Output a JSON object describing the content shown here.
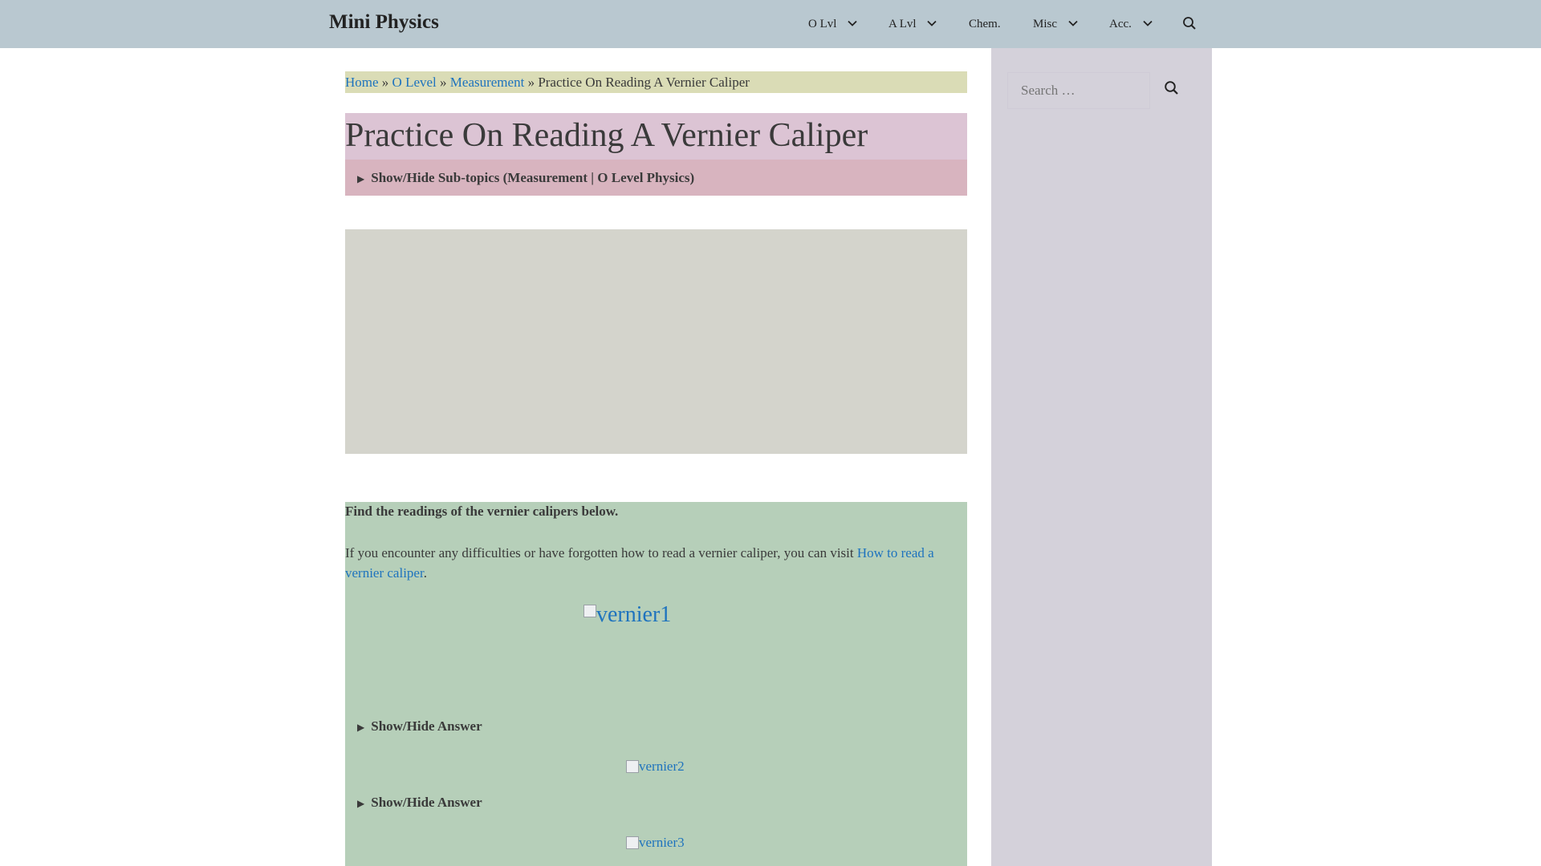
{
  "header": {
    "site_title": "Mini Physics",
    "nav": [
      {
        "label": "O Lvl",
        "has_dropdown": true
      },
      {
        "label": "A Lvl",
        "has_dropdown": true
      },
      {
        "label": "Chem.",
        "has_dropdown": false
      },
      {
        "label": "Misc",
        "has_dropdown": true
      },
      {
        "label": "Acc.",
        "has_dropdown": true
      }
    ],
    "search_icon": "search-icon"
  },
  "breadcrumb": {
    "items": [
      "Home",
      "O Level",
      "Measurement"
    ],
    "separator": "»",
    "current": "Practice On Reading A Vernier Caliper"
  },
  "page": {
    "title": "Practice On Reading A Vernier Caliper",
    "subtopics_toggle": "Show/Hide Sub-topics (Measurement | O Level Physics)"
  },
  "article": {
    "intro_bold": "Find the readings of the vernier calipers below.",
    "intro_text": "If you encounter any difficulties or have forgotten how to read a vernier caliper, you can visit ",
    "intro_link": "How to read a vernier caliper",
    "intro_end": ".",
    "images": [
      {
        "alt": "vernier1"
      },
      {
        "alt": "vernier2"
      },
      {
        "alt": "vernier3"
      }
    ],
    "answer_toggle": "Show/Hide Answer"
  },
  "sidebar": {
    "search_placeholder": "Search …",
    "search_button_icon": "search-icon"
  },
  "colors": {
    "header_bg": "#b9c8d0",
    "breadcrumb_bg": "#dadcb6",
    "title_bg": "#dcc4d4",
    "subtopics_bg": "#d8b4bf",
    "ad_bg": "#d4d4cc",
    "article_bg": "#b6cfb9",
    "sidebar_bg": "#d4d1da",
    "link": "#1e73be"
  }
}
